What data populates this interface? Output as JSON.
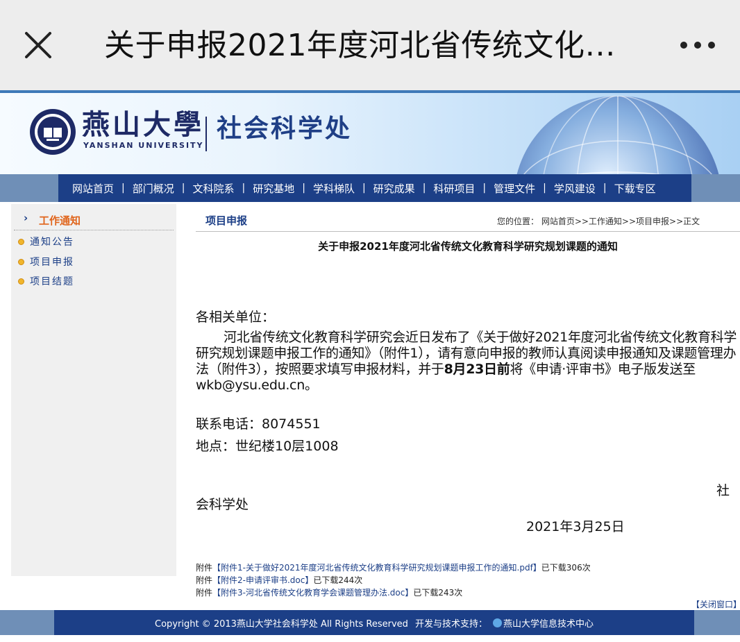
{
  "appbar": {
    "title": "关于申报2021年度河北省传统文化…",
    "close_icon": "close-icon",
    "more_icon": "more-dots-icon"
  },
  "banner": {
    "university_cn": "燕山大學",
    "university_en": "YANSHAN UNIVERSITY",
    "department": "社会科学处",
    "brand_color": "#1c3f87"
  },
  "nav": {
    "items": [
      "网站首页",
      "部门概况",
      "文科院系",
      "研究基地",
      "学科梯队",
      "研究成果",
      "科研项目",
      "管理文件",
      "学风建设",
      "下载专区"
    ]
  },
  "sidebar": {
    "heading": "工作通知",
    "items": [
      "通知公告",
      "项目申报",
      "项目结题"
    ]
  },
  "main": {
    "section": "项目申报",
    "location": "您的位置： 网站首页>>工作通知>>项目申报>>正文",
    "title": "关于申报2021年度河北省传统文化教育科学研究规划课题的通知",
    "greeting": "各相关单位：",
    "body_part1": "河北省传统文化教育科学研究会近日发布了《关于做好2021年度河北省传统文化教育科学研究规划课题申报工作的通知》（附件1），请有意向申报的教师认真阅读申报通知及课题管理办法（附件3），按照要求填写申报材料，并于",
    "body_deadline": "8月23日前",
    "body_part2": "将《申请·评审书》电子版发送至wkb@ysu.edu.cn。",
    "contact": "联系电话：8074551",
    "address": "地点：世纪楼10层1008",
    "signature_a": "社",
    "signature_b": "会科学处",
    "date": "2021年3月25日",
    "attachments": [
      {
        "prefix": "附件",
        "name": "【附件1-关于做好2021年度河北省传统文化教育科学研究规划课题申报工作的通知.pdf】",
        "downloads": "已下载306次"
      },
      {
        "prefix": "附件",
        "name": "【附件2-申请评审书.doc】",
        "downloads": "已下载244次"
      },
      {
        "prefix": "附件",
        "name": "【附件3-河北省传统文化教育学会课题管理办法.doc】",
        "downloads": "已下载243次"
      }
    ],
    "close_window": "【关闭窗口】"
  },
  "footer": {
    "copyright": "Copyright © 2013燕山大学社会科学处 All Rights Reserved",
    "support_label": "开发与技术支持：",
    "support_org": "燕山大学信息技术中心"
  }
}
